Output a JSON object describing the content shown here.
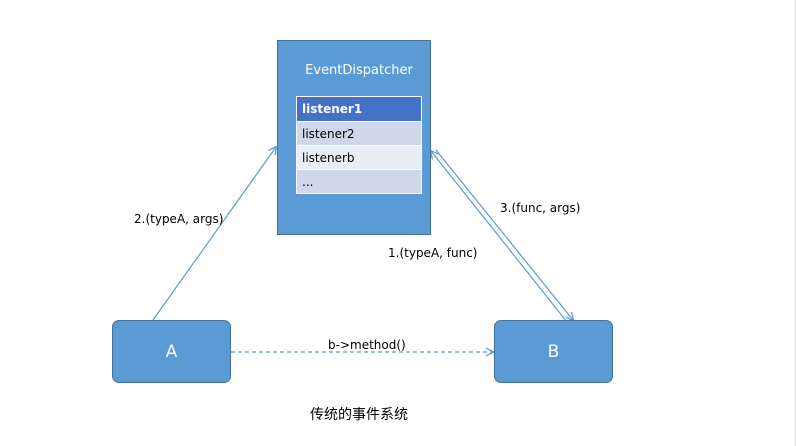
{
  "colors": {
    "box_fill": "#5b9bd5",
    "box_border": "#41719c",
    "line": "#5b9bd5",
    "table_header": "#4472c4",
    "table_row_odd": "#cfd8ea",
    "table_row_even": "#e9edf5"
  },
  "dispatcher": {
    "title": "EventDispatcher",
    "listeners": [
      "listener1",
      "listener2",
      "listenerb",
      "..."
    ]
  },
  "nodes": {
    "a": "A",
    "b": "B"
  },
  "edges": {
    "a_to_dispatcher": "2.(typeA, args)",
    "dispatcher_to_b": "3.(func, args)",
    "b_to_dispatcher": "1.(typeA, func)",
    "a_to_b": "b->method()"
  },
  "caption": "传统的事件系统"
}
